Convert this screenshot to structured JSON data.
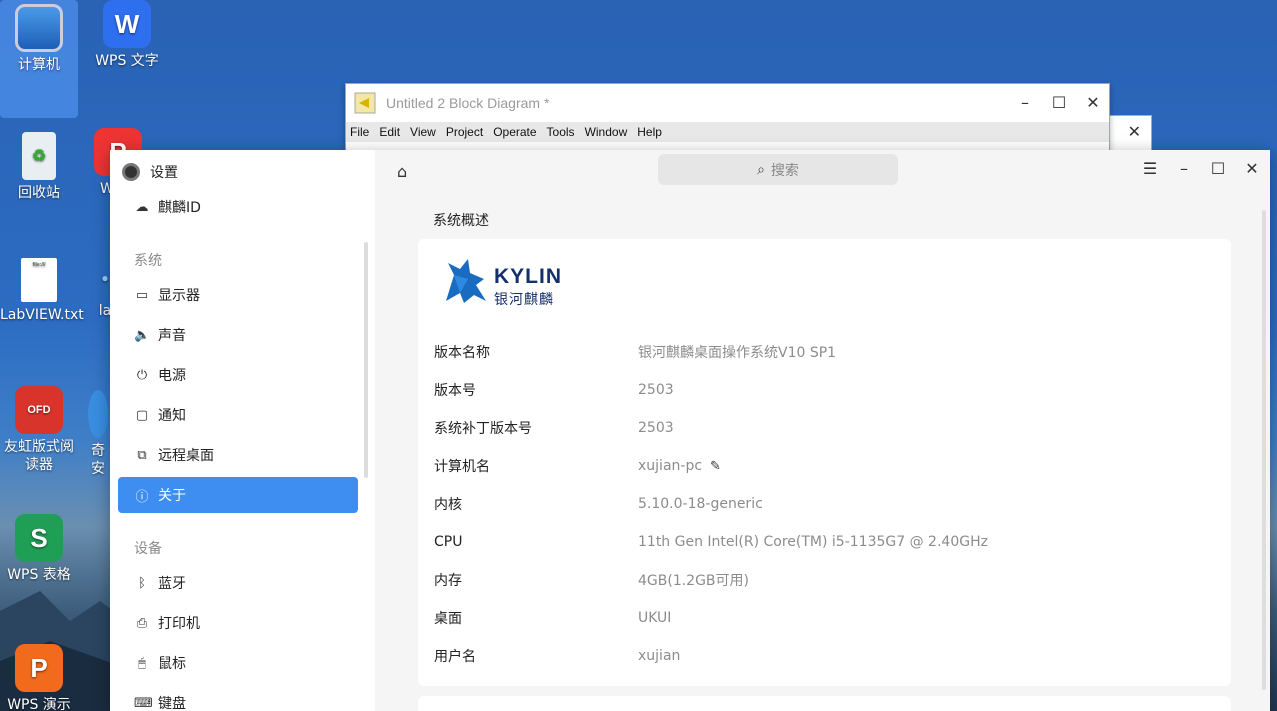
{
  "desktop": {
    "icons": [
      {
        "label": "计算机"
      },
      {
        "label": "WPS 文字"
      },
      {
        "label": "回收站"
      },
      {
        "label": "LabVIEW.txt"
      },
      {
        "label": "友虹版式阅读器"
      },
      {
        "label": "WPS 表格"
      },
      {
        "label": "WPS 演示"
      },
      {
        "label": "W"
      },
      {
        "label": "la"
      },
      {
        "label": "奇安"
      }
    ]
  },
  "labview": {
    "title": "Untitled 2 Block Diagram *",
    "menu": [
      "File",
      "Edit",
      "View",
      "Project",
      "Operate",
      "Tools",
      "Window",
      "Help"
    ]
  },
  "settings": {
    "app_title": "设置",
    "search_placeholder": "搜索",
    "kylin_id": "麒麟ID",
    "section_system": "系统",
    "section_devices": "设备",
    "nav": {
      "display": "显示器",
      "sound": "声音",
      "power": "电源",
      "notify": "通知",
      "remote": "远程桌面",
      "about": "关于",
      "bluetooth": "蓝牙",
      "printer": "打印机",
      "mouse": "鼠标",
      "keyboard": "键盘"
    },
    "page_title": "系统概述",
    "logo": {
      "brand": "KYLIN",
      "sub": "银河麒麟"
    },
    "info": [
      {
        "key": "版本名称",
        "value": "银河麒麟桌面操作系统V10 SP1"
      },
      {
        "key": "版本号",
        "value": "2503"
      },
      {
        "key": "系统补丁版本号",
        "value": "2503"
      },
      {
        "key": "计算机名",
        "value": "xujian-pc"
      },
      {
        "key": "内核",
        "value": "5.10.0-18-generic"
      },
      {
        "key": "CPU",
        "value": "11th Gen Intel(R) Core(TM) i5-1135G7 @ 2.40GHz"
      },
      {
        "key": "内存",
        "value": "4GB(1.2GB可用)"
      },
      {
        "key": "桌面",
        "value": "UKUI"
      },
      {
        "key": "用户名",
        "value": "xujian"
      }
    ]
  }
}
